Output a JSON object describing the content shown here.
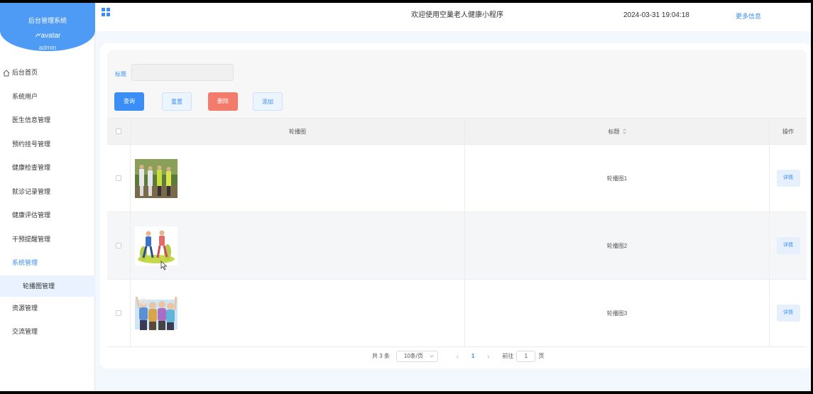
{
  "sidebar": {
    "brand_title": "后台管理系统",
    "avatar_alt": "avatar",
    "username": "admin",
    "items": [
      {
        "label": "后台首页"
      },
      {
        "label": "系统用户"
      },
      {
        "label": "医生信息管理"
      },
      {
        "label": "预约挂号管理"
      },
      {
        "label": "健康检查管理"
      },
      {
        "label": "就诊记录管理"
      },
      {
        "label": "健康评估管理"
      },
      {
        "label": "干预提醒管理"
      },
      {
        "label": "系统管理"
      },
      {
        "label": "轮播图管理"
      },
      {
        "label": "资源管理"
      },
      {
        "label": "交流管理"
      }
    ]
  },
  "header": {
    "title": "欢迎使用空巢老人健康小程序",
    "datetime": "2024-03-31 19:04:18",
    "more": "更多信息"
  },
  "search": {
    "title_label": "标题",
    "title_value": ""
  },
  "actions": {
    "query": "查询",
    "reset": "重置",
    "delete": "删除",
    "add": "添加"
  },
  "table": {
    "columns": {
      "image": "轮播图",
      "title": "标题",
      "op": "操作"
    },
    "rows": [
      {
        "title": "轮播图1",
        "detail": "详情",
        "image_icon": "tai-chi-seniors-photo"
      },
      {
        "title": "轮播图2",
        "detail": "详情",
        "image_icon": "walking-couple-illustration"
      },
      {
        "title": "轮播图3",
        "detail": "详情",
        "image_icon": "cheering-seniors-illustration"
      }
    ]
  },
  "pagination": {
    "total": "共 3 条",
    "page_size": "10条/页",
    "current_page": "1",
    "goto_label": "前往",
    "goto_value": "1",
    "page_suffix": "页"
  },
  "colors": {
    "primary": "#3a8ef5",
    "danger": "#f27b6b",
    "brand": "#4e9bf5"
  }
}
